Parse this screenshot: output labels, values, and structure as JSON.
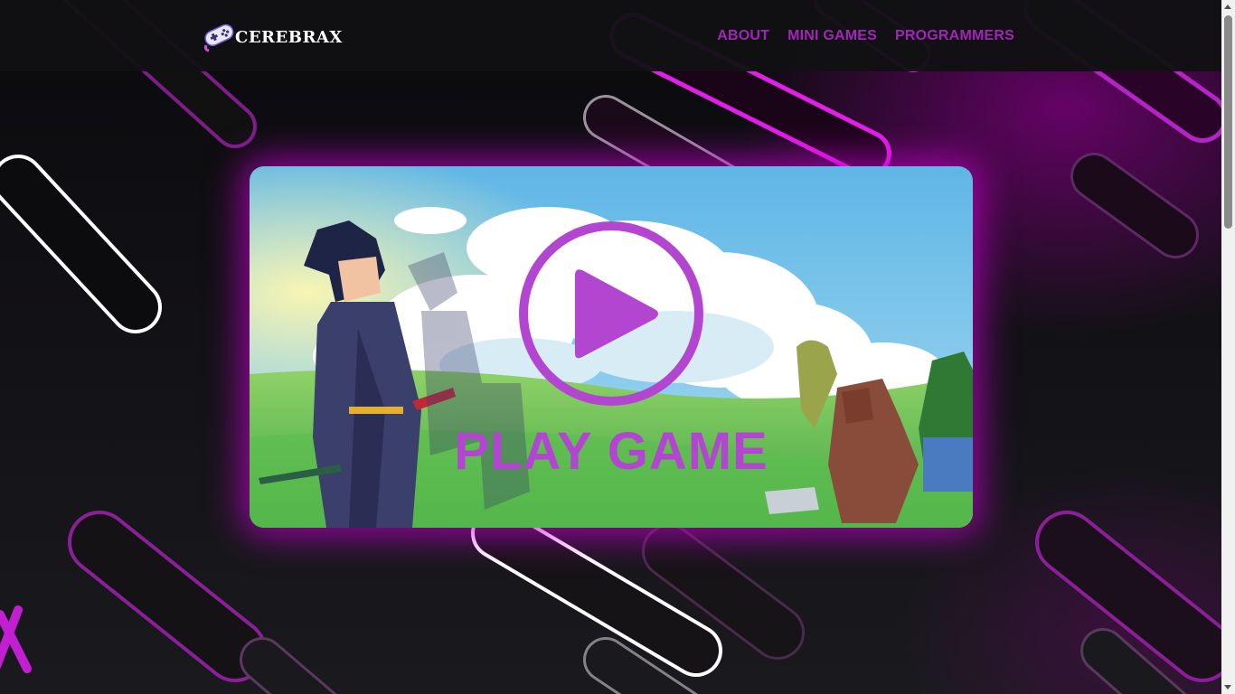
{
  "brand": {
    "name": "CEREBRAX",
    "logo_icon": "gamepad-icon"
  },
  "nav": {
    "items": [
      {
        "label": "ABOUT"
      },
      {
        "label": "MINI GAMES"
      },
      {
        "label": "PROGRAMMERS"
      }
    ]
  },
  "hero": {
    "play_label": "PLAY GAME",
    "play_icon": "play-circle-icon"
  },
  "colors": {
    "accent": "#a224b8",
    "play": "#b346d0",
    "navbar": "#111113",
    "glow": "#c800d2"
  }
}
